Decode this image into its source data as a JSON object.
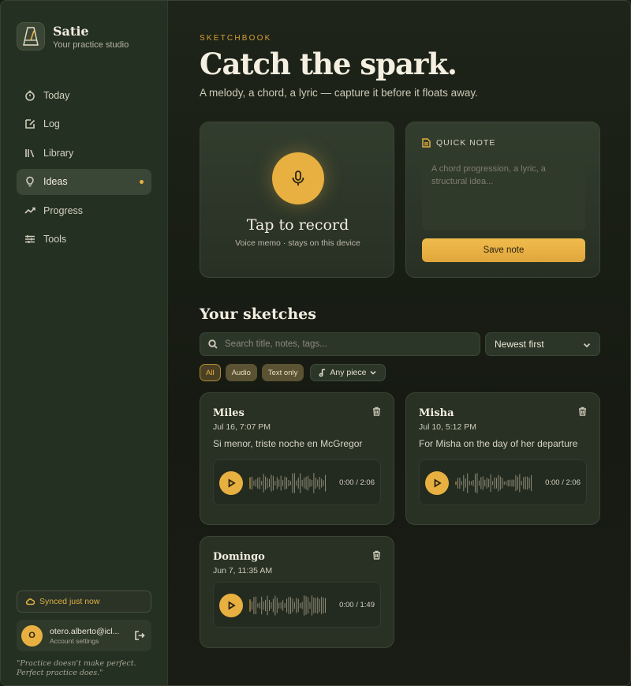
{
  "sidebar": {
    "brand_name": "Satie",
    "brand_sub": "Your practice studio",
    "items": [
      {
        "label": "Today",
        "icon": "timer-icon"
      },
      {
        "label": "Log",
        "icon": "edit-note-icon"
      },
      {
        "label": "Library",
        "icon": "library-icon"
      },
      {
        "label": "Ideas",
        "icon": "lightbulb-icon",
        "active": true
      },
      {
        "label": "Progress",
        "icon": "trend-icon"
      },
      {
        "label": "Tools",
        "icon": "sliders-icon"
      }
    ],
    "sync_status": "Synced just now",
    "account": {
      "initial": "O",
      "email": "otero.alberto@icl...",
      "sub": "Account settings"
    },
    "quote": "\"Practice doesn't make perfect. Perfect practice does.\""
  },
  "header": {
    "eyebrow": "SKETCHBOOK",
    "title": "Catch the spark.",
    "subtitle": "A melody, a chord, a lyric — capture it before it floats away."
  },
  "record": {
    "title": "Tap to record",
    "sub": "Voice memo · stays on this device"
  },
  "quick_note": {
    "label": "QUICK NOTE",
    "placeholder": "A chord progression, a lyric, a structural idea...",
    "value": "",
    "save_label": "Save note"
  },
  "sketches_section": {
    "title": "Your sketches",
    "search_placeholder": "Search title, notes, tags...",
    "sort_value": "Newest first",
    "filters": [
      {
        "label": "All",
        "active": true
      },
      {
        "label": "Audio",
        "active": false
      },
      {
        "label": "Text only",
        "active": false
      }
    ],
    "piece_filter": "Any piece"
  },
  "sketches": [
    {
      "name": "Miles",
      "date": "Jul 16, 7:07 PM",
      "note": "Si menor, triste noche en McGregor",
      "time": "0:00 / 2:06",
      "progress": 0
    },
    {
      "name": "Misha",
      "date": "Jul 10, 5:12 PM",
      "note": "For Misha on the day of her departure",
      "time": "0:00 / 2:06",
      "progress": 0
    },
    {
      "name": "Domingo",
      "date": "Jun 7, 11:35 AM",
      "note": "",
      "time": "0:00 / 1:49",
      "progress": 0
    }
  ],
  "colors": {
    "accent": "#e8b040",
    "sidebar_bg": "#243022",
    "card_bg": "#2a3326"
  }
}
